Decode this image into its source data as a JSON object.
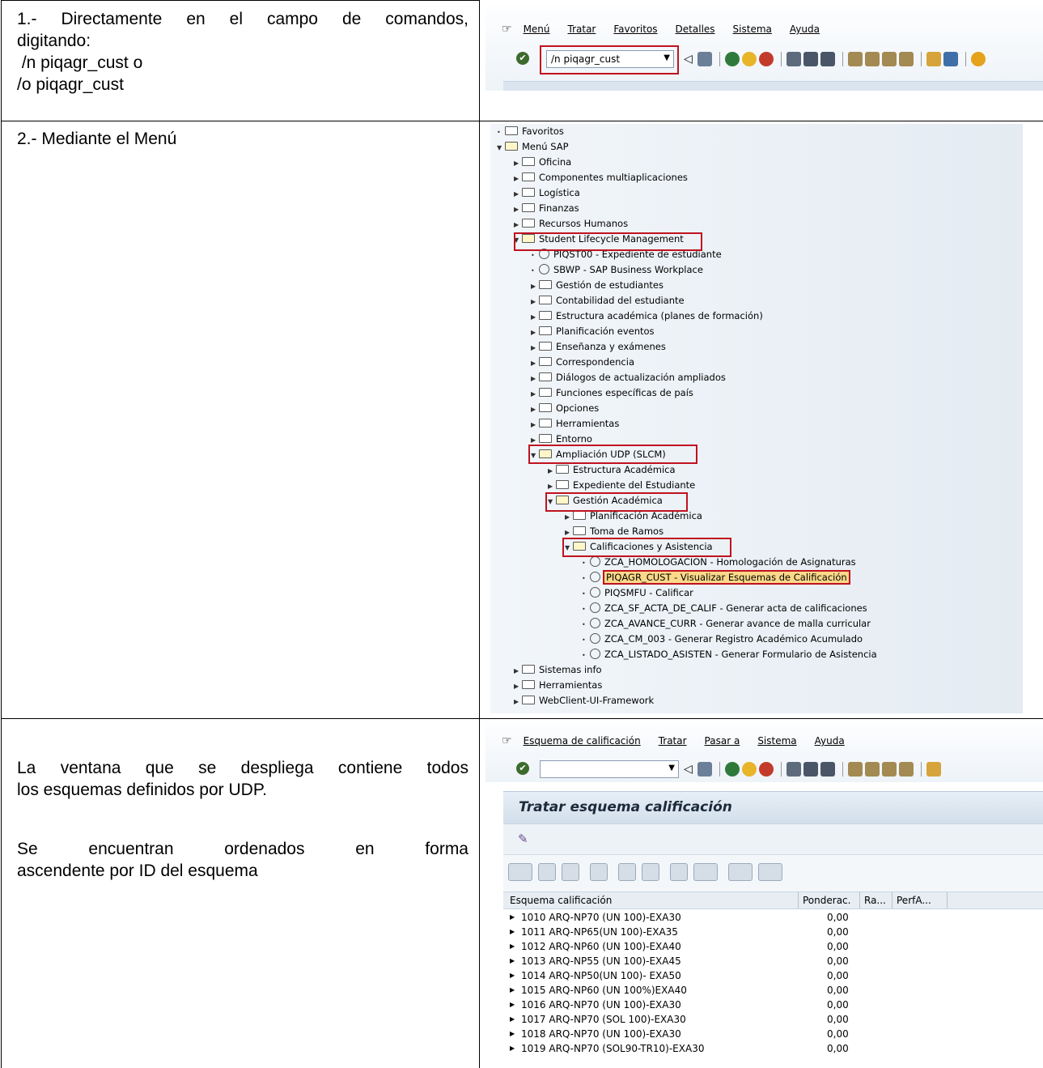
{
  "rows": {
    "r1": {
      "lines": [
        "1.- Directamente en el campo de comandos,",
        "digitando:",
        " /n piqagr_cust o",
        "/o piqagr_cust"
      ]
    },
    "r2": {
      "text": "2.- Mediante el Menú"
    },
    "r3": {
      "para1": [
        "La ventana que se despliega contiene todos",
        "los esquemas definidos por UDP."
      ],
      "para2": [
        "Se encuentran ordenados en forma",
        "ascendente por ID del esquema"
      ]
    }
  },
  "sap1": {
    "menu": [
      "Menú",
      "Tratar",
      "Favoritos",
      "Detalles",
      "Sistema",
      "Ayuda"
    ],
    "command_value": "/n piqagr_cust"
  },
  "tree": {
    "items": [
      {
        "label": "Favoritos",
        "level": 0,
        "kind": "folder",
        "state": "bullet"
      },
      {
        "label": "Menú SAP",
        "level": 0,
        "kind": "folder-open",
        "state": "open"
      },
      {
        "label": "Oficina",
        "level": 1,
        "kind": "folder",
        "state": "closed"
      },
      {
        "label": "Componentes multiaplicaciones",
        "level": 1,
        "kind": "folder",
        "state": "closed"
      },
      {
        "label": "Logística",
        "level": 1,
        "kind": "folder",
        "state": "closed"
      },
      {
        "label": "Finanzas",
        "level": 1,
        "kind": "folder",
        "state": "closed"
      },
      {
        "label": "Recursos Humanos",
        "level": 1,
        "kind": "folder",
        "state": "closed"
      },
      {
        "label": "Student Lifecycle Management",
        "level": 1,
        "kind": "folder-open",
        "state": "open"
      },
      {
        "label": "PIQST00 - Expediente de estudiante",
        "level": 2,
        "kind": "tx",
        "state": "bullet"
      },
      {
        "label": "SBWP - SAP Business Workplace",
        "level": 2,
        "kind": "tx",
        "state": "bullet"
      },
      {
        "label": "Gestión de estudiantes",
        "level": 2,
        "kind": "folder",
        "state": "closed"
      },
      {
        "label": "Contabilidad del estudiante",
        "level": 2,
        "kind": "folder",
        "state": "closed"
      },
      {
        "label": "Estructura académica (planes de formación)",
        "level": 2,
        "kind": "folder",
        "state": "closed"
      },
      {
        "label": "Planificación eventos",
        "level": 2,
        "kind": "folder",
        "state": "closed"
      },
      {
        "label": "Enseñanza y exámenes",
        "level": 2,
        "kind": "folder",
        "state": "closed"
      },
      {
        "label": "Correspondencia",
        "level": 2,
        "kind": "folder",
        "state": "closed"
      },
      {
        "label": "Diálogos de actualización ampliados",
        "level": 2,
        "kind": "folder",
        "state": "closed"
      },
      {
        "label": "Funciones específicas de país",
        "level": 2,
        "kind": "folder",
        "state": "closed"
      },
      {
        "label": "Opciones",
        "level": 2,
        "kind": "folder",
        "state": "closed"
      },
      {
        "label": "Herramientas",
        "level": 2,
        "kind": "folder",
        "state": "closed"
      },
      {
        "label": "Entorno",
        "level": 2,
        "kind": "folder",
        "state": "closed"
      },
      {
        "label": "Ampliación UDP (SLCM)",
        "level": 2,
        "kind": "folder-open",
        "state": "open"
      },
      {
        "label": "Estructura Académica",
        "level": 3,
        "kind": "folder",
        "state": "closed"
      },
      {
        "label": "Expediente del Estudiante",
        "level": 3,
        "kind": "folder",
        "state": "closed"
      },
      {
        "label": "Gestión Académica",
        "level": 3,
        "kind": "folder-open",
        "state": "open"
      },
      {
        "label": "Planificación Académica",
        "level": 4,
        "kind": "folder",
        "state": "closed"
      },
      {
        "label": "Toma de Ramos",
        "level": 4,
        "kind": "folder",
        "state": "closed"
      },
      {
        "label": "Calificaciones y Asistencia",
        "level": 4,
        "kind": "folder-open",
        "state": "open"
      },
      {
        "label": "ZCA_HOMOLOGACION - Homologación de Asignaturas",
        "level": 5,
        "kind": "tx",
        "state": "bullet"
      },
      {
        "label": "PIQAGR_CUST - Visualizar Esquemas de Calificación",
        "level": 5,
        "kind": "tx",
        "state": "bullet"
      },
      {
        "label": "PIQSMFU - Calificar",
        "level": 5,
        "kind": "tx",
        "state": "bullet"
      },
      {
        "label": "ZCA_SF_ACTA_DE_CALIF - Generar acta de calificaciones",
        "level": 5,
        "kind": "tx",
        "state": "bullet"
      },
      {
        "label": "ZCA_AVANCE_CURR - Generar avance de malla curricular",
        "level": 5,
        "kind": "tx",
        "state": "bullet"
      },
      {
        "label": "ZCA_CM_003 - Generar Registro Académico Acumulado",
        "level": 5,
        "kind": "tx",
        "state": "bullet"
      },
      {
        "label": "ZCA_LISTADO_ASISTEN - Generar Formulario de Asistencia",
        "level": 5,
        "kind": "tx",
        "state": "bullet"
      },
      {
        "label": "Sistemas info",
        "level": 1,
        "kind": "folder",
        "state": "closed"
      },
      {
        "label": "Herramientas",
        "level": 1,
        "kind": "folder",
        "state": "closed"
      },
      {
        "label": "WebClient-UI-Framework",
        "level": 1,
        "kind": "folder",
        "state": "closed"
      }
    ]
  },
  "sap3": {
    "menu": [
      "Esquema de calificación",
      "Tratar",
      "Pasar a",
      "Sistema",
      "Ayuda"
    ],
    "title": "Tratar esquema calificación",
    "columns": [
      "Esquema calificación",
      "Ponderac.",
      "Ra...",
      "PerfA..."
    ],
    "rows": [
      {
        "name": "1010 ARQ-NP70 (UN 100)-EXA30",
        "pond": "0,00"
      },
      {
        "name": "1011 ARQ-NP65(UN 100)-EXA35",
        "pond": "0,00"
      },
      {
        "name": "1012 ARQ-NP60 (UN 100)-EXA40",
        "pond": "0,00"
      },
      {
        "name": "1013 ARQ-NP55 (UN 100)-EXA45",
        "pond": "0,00"
      },
      {
        "name": "1014 ARQ-NP50(UN 100)- EXA50",
        "pond": "0,00"
      },
      {
        "name": "1015 ARQ-NP60 (UN 100%)EXA40",
        "pond": "0,00"
      },
      {
        "name": "1016 ARQ-NP70 (UN 100)-EXA30",
        "pond": "0,00"
      },
      {
        "name": "1017 ARQ-NP70 (SOL 100)-EXA30",
        "pond": "0,00"
      },
      {
        "name": "1018 ARQ-NP70 (UN 100)-EXA30",
        "pond": "0,00"
      },
      {
        "name": "1019 ARQ-NP70 (SOL90-TR10)-EXA30",
        "pond": "0,00"
      }
    ]
  },
  "colors": {
    "red_highlight": "#c0121f",
    "tree_bg": "#e9eef4",
    "header_bg": "#dde7f0",
    "selected_row": "#fbd989"
  }
}
